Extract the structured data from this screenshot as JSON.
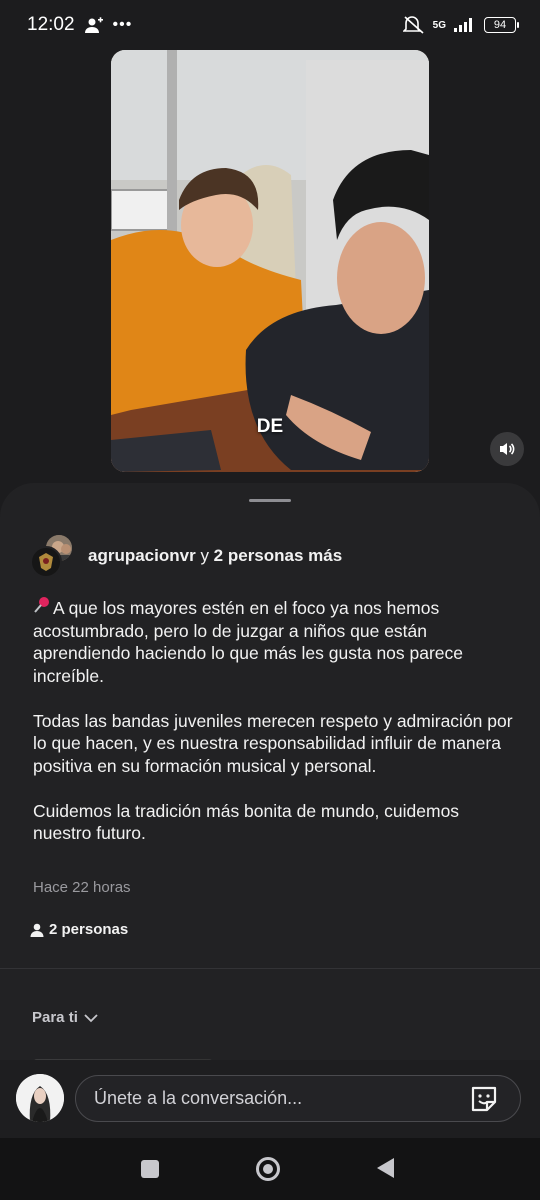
{
  "status_bar": {
    "time": "12:02",
    "network": "5G",
    "battery": "94"
  },
  "video": {
    "caption": "DE"
  },
  "post": {
    "author": "agrupacionvr",
    "author_connector": "y",
    "coauthors": "2 personas más",
    "paragraphs": [
      "A que los mayores estén en el foco ya nos hemos acostumbrado, pero lo de juzgar a niños que están aprendiendo haciendo lo que más les gusta nos parece increíble.",
      "Todas las bandas juveniles merecen respeto y admiración por lo que hacen, y es nuestra responsabilidad influir de manera positiva en su formación musical y personal.",
      "Cuidemos la tradición más bonita de mundo, cuidemos nuestro futuro."
    ],
    "timestamp": "Hace 22 horas",
    "people_count": "2 personas"
  },
  "comments": {
    "sort_label": "Para ti"
  },
  "composer": {
    "placeholder": "Únete a la conversación..."
  },
  "icons": [
    "person-icon",
    "more-icon",
    "mute-icon",
    "signal-icon",
    "battery-icon",
    "volume-icon",
    "pin-icon",
    "person-icon",
    "chevron-down-icon",
    "sticker-icon"
  ]
}
